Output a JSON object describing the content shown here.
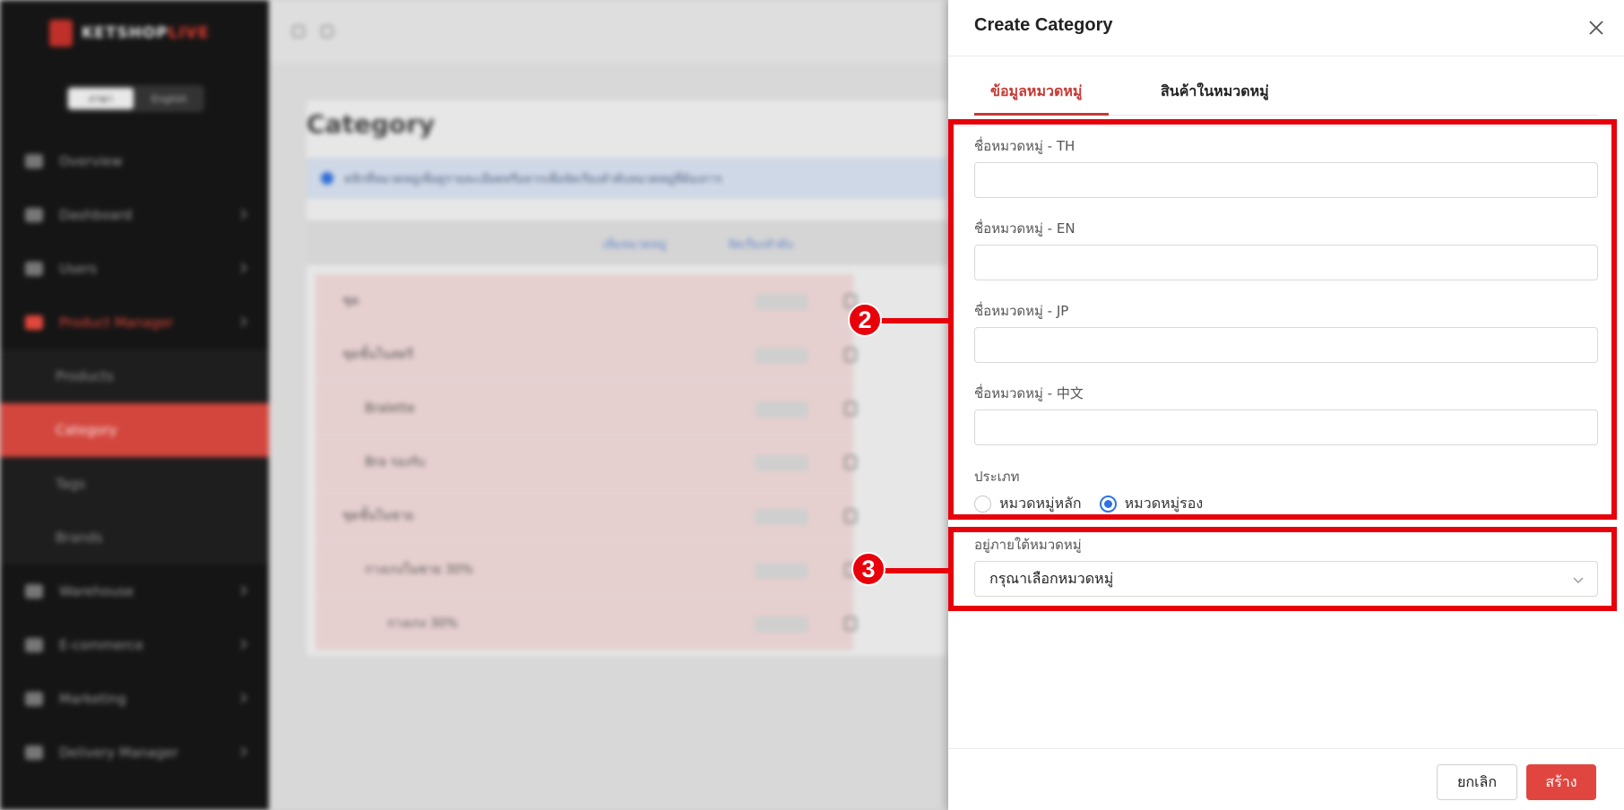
{
  "background": {
    "logo_text": "KETSHOP",
    "logo_accent": "LIVE",
    "lang_options": [
      "ภาษา",
      "English"
    ],
    "nav": [
      {
        "label": "Overview"
      },
      {
        "label": "Dashboard"
      },
      {
        "label": "Users"
      },
      {
        "label": "Product Manager"
      }
    ],
    "sub_nav": [
      "Products",
      "Category",
      "Tags",
      "Brands"
    ],
    "nav_bottom": [
      {
        "label": "Warehouse"
      },
      {
        "label": "E-commerce"
      },
      {
        "label": "Marketing"
      },
      {
        "label": "Delivery Manager"
      }
    ],
    "page_title": "Category",
    "info_text": "คลิกที่หมวดหมู่เพื่อดูรายละเอียดหรือลากเพื่อจัดเรียงลำดับหมวดหมู่ที่ต้องการ",
    "toolbar": [
      "เพิ่มหมวดหมู่",
      "จัดเรียงลำดับ"
    ],
    "rows": [
      {
        "name": "ชุด"
      },
      {
        "name": "ชุดชั้นในสตรี"
      },
      {
        "name": "Bralette"
      },
      {
        "name": "Bra รองรับ"
      },
      {
        "name": "ชุดชั้นในชาย"
      },
      {
        "name": "กางเกงในชาย 30%"
      },
      {
        "name": "กางเกง 30%"
      }
    ]
  },
  "drawer": {
    "title": "Create Category",
    "tabs": {
      "info": "ข้อมูลหมวดหมู่",
      "products": "สินค้าในหมวดหมู่"
    },
    "fields": {
      "name_th_label": "ชื่อหมวดหมู่ - TH",
      "name_en_label": "ชื่อหมวดหมู่ - EN",
      "name_jp_label": "ชื่อหมวดหมู่ - JP",
      "name_cn_label": "ชื่อหมวดหมู่ - 中文",
      "name_th_value": "",
      "name_en_value": "",
      "name_jp_value": "",
      "name_cn_value": ""
    },
    "type": {
      "label": "ประเภท",
      "options": [
        "หมวดหมู่หลัก",
        "หมวดหมู่รอง"
      ],
      "selected": "หมวดหมู่รอง"
    },
    "parent": {
      "label": "อยู่ภายใต้หมวดหมู่",
      "placeholder": "กรุณาเลือกหมวดหมู่"
    },
    "footer": {
      "cancel": "ยกเลิก",
      "create": "สร้าง"
    }
  },
  "annotations": {
    "box_2_number": "2",
    "box_3_number": "3",
    "color": "#e8000b"
  },
  "colors": {
    "primary_red": "#e0463f",
    "tab_active": "#c73a34",
    "radio_blue": "#2f72e0"
  }
}
